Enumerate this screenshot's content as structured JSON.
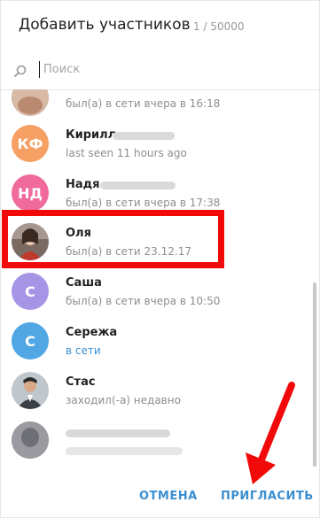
{
  "dialog": {
    "title": "Добавить участников",
    "counter": "1 / 50000"
  },
  "search": {
    "placeholder": "Поиск",
    "value": ""
  },
  "contacts": [
    {
      "name": "",
      "status": "был(а) в сети вчера в 16:18",
      "avatar": "photo"
    },
    {
      "name": "Кирилл",
      "status": "last seen 11 hours ago",
      "avatar": "КФ",
      "avatar_color": "#f6a064"
    },
    {
      "name": "Надя",
      "status": "был(а) в сети вчера в 17:38",
      "avatar": "НД",
      "avatar_color": "#f06a9c"
    },
    {
      "name": "Оля",
      "status": "был(а) в сети 23.12.17",
      "avatar": "photo"
    },
    {
      "name": "Саша",
      "status": "был(а) в сети вчера в 10:50",
      "avatar": "С",
      "avatar_color": "#a695e7"
    },
    {
      "name": "Сережа",
      "status": "в сети",
      "avatar": "С",
      "avatar_color": "#50a7e3"
    },
    {
      "name": "Стас",
      "status": "заходил(-а) недавно",
      "avatar": "photo"
    },
    {
      "name": "",
      "status": "",
      "avatar": "photo"
    }
  ],
  "buttons": {
    "cancel": "ОТМЕНА",
    "invite": "ПРИГЛАСИТЬ"
  },
  "colors": {
    "accent": "#3a8fd1",
    "annotation": "#f20a0a"
  },
  "icons": {
    "search": "search-icon",
    "annotation_arrow": "arrow-annotation"
  }
}
